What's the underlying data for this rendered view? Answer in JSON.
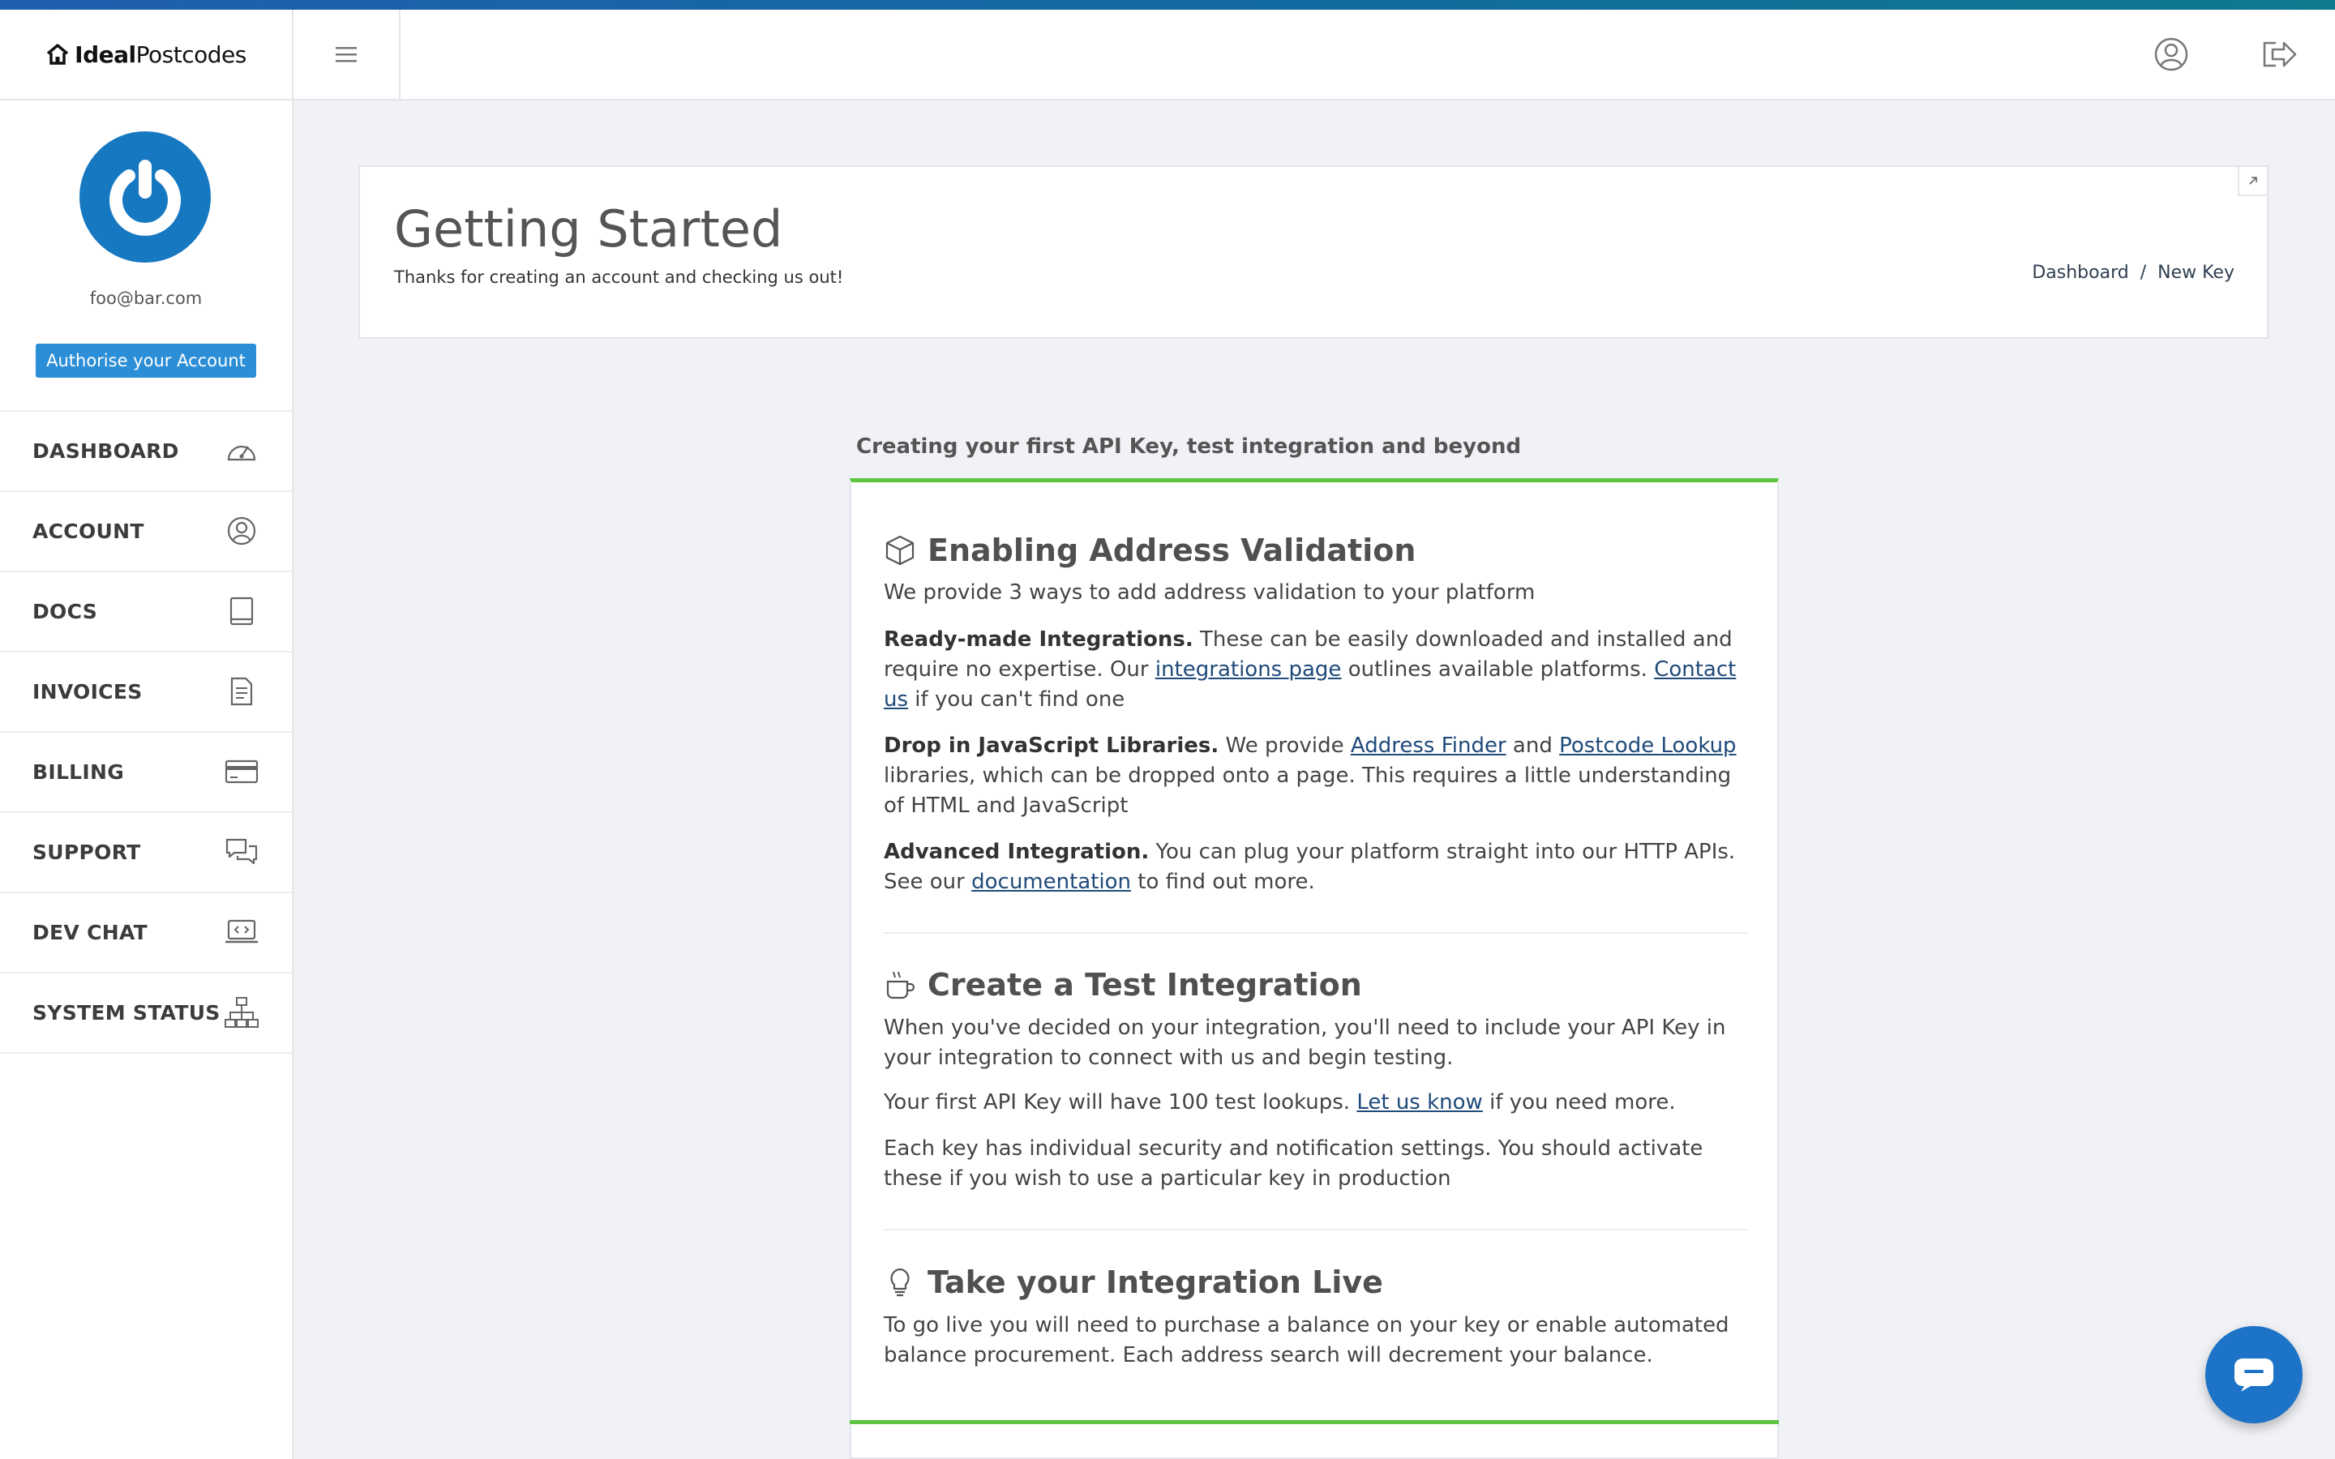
{
  "header": {
    "logo_bold": "Ideal",
    "logo_light": "Postcodes",
    "icons": [
      "menu-icon",
      "user-icon",
      "logout-icon"
    ]
  },
  "sidebar": {
    "email": "foo@bar.com",
    "authorise_label": "Authorise your Account",
    "items": [
      {
        "label": "DASHBOARD",
        "icon": "speedometer-icon"
      },
      {
        "label": "ACCOUNT",
        "icon": "user-circle-icon"
      },
      {
        "label": "DOCS",
        "icon": "book-icon"
      },
      {
        "label": "INVOICES",
        "icon": "document-icon"
      },
      {
        "label": "BILLING",
        "icon": "credit-card-icon"
      },
      {
        "label": "SUPPORT",
        "icon": "chat-bubbles-icon"
      },
      {
        "label": "DEV CHAT",
        "icon": "laptop-code-icon"
      },
      {
        "label": "SYSTEM STATUS",
        "icon": "network-icon"
      }
    ]
  },
  "page": {
    "title": "Getting Started",
    "subtitle": "Thanks for creating an account and checking us out!",
    "breadcrumb": [
      "Dashboard",
      "New Key"
    ]
  },
  "guide": {
    "heading": "Creating your first API Key, test integration and beyond",
    "section1": {
      "title": "Enabling Address Validation",
      "intro": "We provide 3 ways to add address validation to your platform",
      "p1_bold": "Ready-made Integrations.",
      "p1_a": " These can be easily downloaded and installed and require no expertise. Our ",
      "p1_link1": "integrations page",
      "p1_b": " outlines available platforms. ",
      "p1_link2": "Contact us",
      "p1_c": " if you can't find one",
      "p2_bold": "Drop in JavaScript Libraries.",
      "p2_a": " We provide ",
      "p2_link1": "Address Finder",
      "p2_b": " and ",
      "p2_link2": "Postcode Lookup",
      "p2_c": " libraries, which can be dropped onto a page. This requires a little understanding of HTML and JavaScript",
      "p3_bold": "Advanced Integration.",
      "p3_a": " You can plug your platform straight into our HTTP APIs. See our ",
      "p3_link": "documentation",
      "p3_b": " to find out more."
    },
    "section2": {
      "title": "Create a Test Integration",
      "p1": "When you've decided on your integration, you'll need to include your API Key in your integration to connect with us and begin testing.",
      "p2_a": "Your first API Key will have 100 test lookups. ",
      "p2_link": "Let us know",
      "p2_b": " if you need more.",
      "p3": "Each key has individual security and notification settings. You should activate these if you wish to use a particular key in production"
    },
    "section3": {
      "title": "Take your Integration Live",
      "p1": "To go live you will need to purchase a balance on your key or enable automated balance procurement. Each address search will decrement your balance."
    }
  },
  "colors": {
    "accent_green": "#5cc43f",
    "primary_blue": "#2b8ed6",
    "link": "#1f4a7a"
  }
}
